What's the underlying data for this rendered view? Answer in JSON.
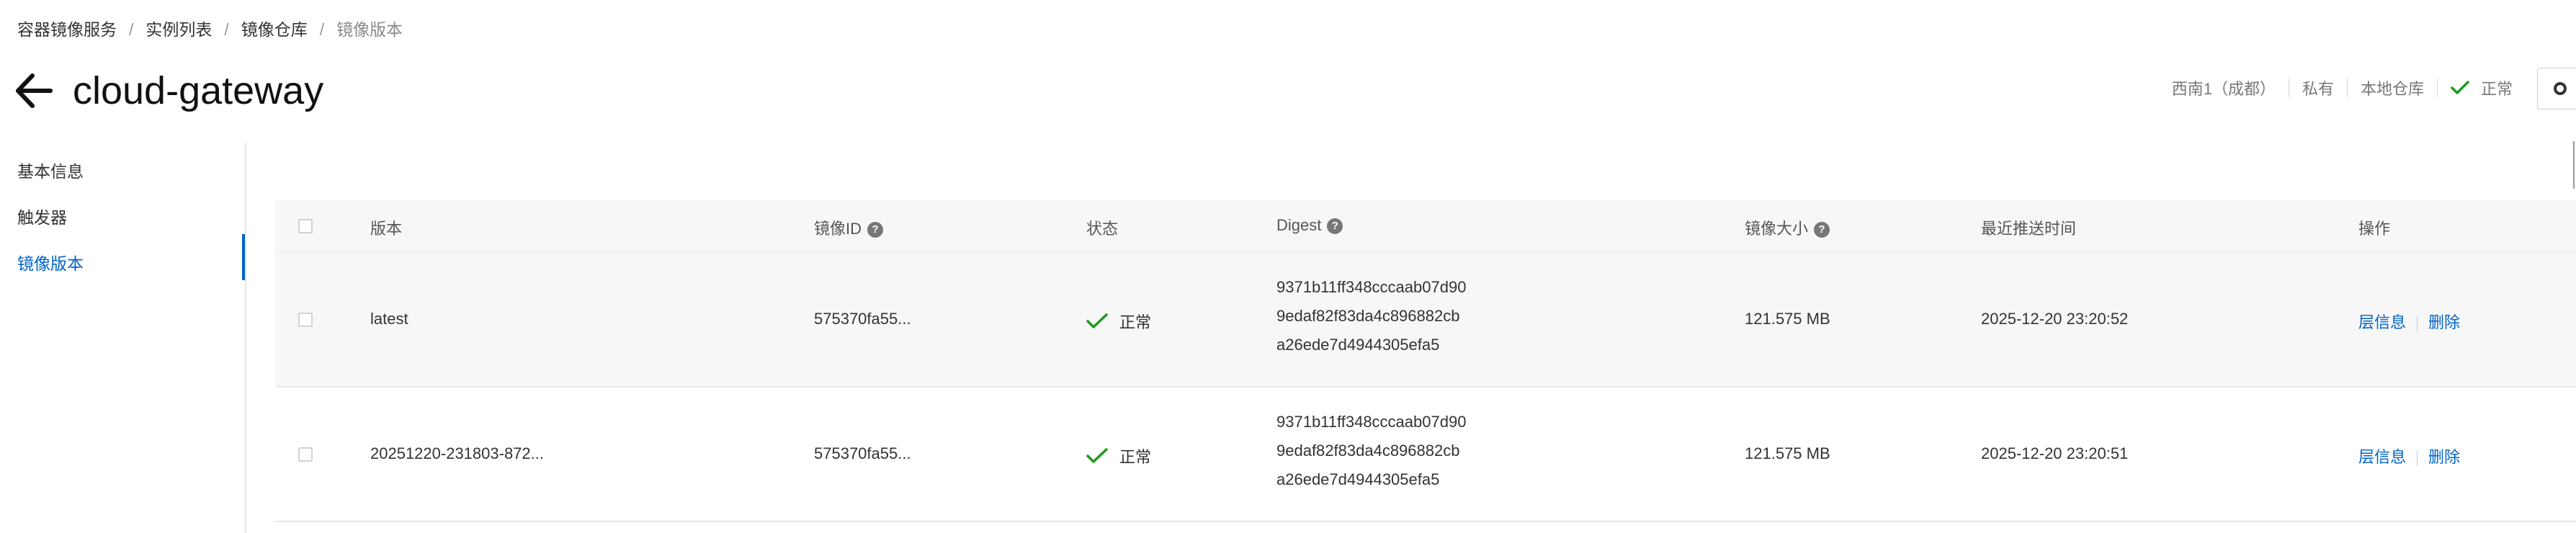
{
  "breadcrumb": {
    "items": [
      "容器镜像服务",
      "实例列表",
      "镜像仓库"
    ],
    "current": "镜像版本",
    "separator": "/"
  },
  "header": {
    "title": "cloud-gateway",
    "region": "西南1（成都）",
    "visibility": "私有",
    "source": "本地仓库",
    "status": "正常"
  },
  "sidebar": {
    "items": [
      {
        "label": "基本信息",
        "active": false
      },
      {
        "label": "触发器",
        "active": false
      },
      {
        "label": "镜像版本",
        "active": true
      }
    ]
  },
  "table": {
    "columns": {
      "version": "版本",
      "image_id": "镜像ID",
      "status": "状态",
      "digest": "Digest",
      "size": "镜像大小",
      "pushed": "最近推送时间",
      "ops": "操作"
    },
    "help_icon": "?",
    "rows": [
      {
        "version": "latest",
        "image_id": "575370fa55...",
        "status": "正常",
        "digest_lines": [
          "9371b11ff348cccaab07d90",
          "9edaf82f83da4c896882cb",
          "a26ede7d4944305efa5"
        ],
        "size": "121.575 MB",
        "pushed": "2025-12-20 23:20:52",
        "op_layers": "层信息",
        "op_delete": "删除"
      },
      {
        "version": "20251220-231803-872...",
        "image_id": "575370fa55...",
        "status": "正常",
        "digest_lines": [
          "9371b11ff348cccaab07d90",
          "9edaf82f83da4c896882cb",
          "a26ede7d4944305efa5"
        ],
        "size": "121.575 MB",
        "pushed": "2025-12-20 23:20:51",
        "op_layers": "层信息",
        "op_delete": "删除"
      }
    ]
  },
  "colors": {
    "accent": "#0064c8",
    "success": "#1e9b1e",
    "header_bg": "#f7f7f7"
  },
  "icons": {
    "back": "arrow-left-icon",
    "status_ok": "check-icon",
    "help": "question-circle-icon",
    "top_button": "gear-icon"
  }
}
